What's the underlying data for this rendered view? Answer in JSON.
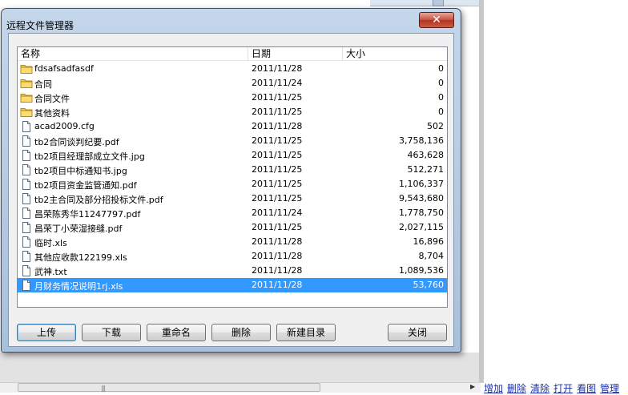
{
  "dialog": {
    "title": "远程文件管理器",
    "close_glyph": "✕"
  },
  "columns": {
    "name": "名称",
    "date": "日期",
    "size": "大小"
  },
  "files": [
    {
      "type": "folder",
      "name": "fdsafsadfasdf",
      "date": "2011/11/28",
      "size": "0"
    },
    {
      "type": "folder",
      "name": "合同",
      "date": "2011/11/24",
      "size": "0"
    },
    {
      "type": "folder",
      "name": "合同文件",
      "date": "2011/11/25",
      "size": "0"
    },
    {
      "type": "folder",
      "name": "其他资料",
      "date": "2011/11/25",
      "size": "0"
    },
    {
      "type": "file",
      "name": "acad2009.cfg",
      "date": "2011/11/28",
      "size": "502"
    },
    {
      "type": "file",
      "name": "tb2合同谈判纪要.pdf",
      "date": "2011/11/25",
      "size": "3,758,136"
    },
    {
      "type": "file",
      "name": "tb2项目经理部成立文件.jpg",
      "date": "2011/11/25",
      "size": "463,628"
    },
    {
      "type": "file",
      "name": "tb2项目中标通知书.jpg",
      "date": "2011/11/25",
      "size": "512,271"
    },
    {
      "type": "file",
      "name": "tb2项目资金监管通知.pdf",
      "date": "2011/11/25",
      "size": "1,106,337"
    },
    {
      "type": "file",
      "name": "tb2主合同及部分招投标文件.pdf",
      "date": "2011/11/25",
      "size": "9,543,680"
    },
    {
      "type": "file",
      "name": "昌荣陈秀华11247797.pdf",
      "date": "2011/11/24",
      "size": "1,778,750"
    },
    {
      "type": "file",
      "name": "昌荣丁小荣湿接缝.pdf",
      "date": "2011/11/25",
      "size": "2,027,115"
    },
    {
      "type": "file",
      "name": "临时.xls",
      "date": "2011/11/28",
      "size": "16,896"
    },
    {
      "type": "file",
      "name": "其他应收款122199.xls",
      "date": "2011/11/28",
      "size": "8,704"
    },
    {
      "type": "file",
      "name": "武神.txt",
      "date": "2011/11/28",
      "size": "1,089,536"
    },
    {
      "type": "file",
      "name": "月财务情况说明1rj.xls",
      "date": "2011/11/28",
      "size": "53,760",
      "selected": true
    }
  ],
  "buttons": {
    "upload": "上传",
    "download": "下载",
    "rename": "重命名",
    "delete": "删除",
    "new_dir": "新建目录",
    "close": "关闭"
  },
  "bg_links": [
    "增加",
    "删除",
    "清除",
    "打开",
    "看图",
    "管理"
  ],
  "colors": {
    "selection": "#3399ff",
    "folder": "#f0c040",
    "link": "#1a2fb0"
  }
}
